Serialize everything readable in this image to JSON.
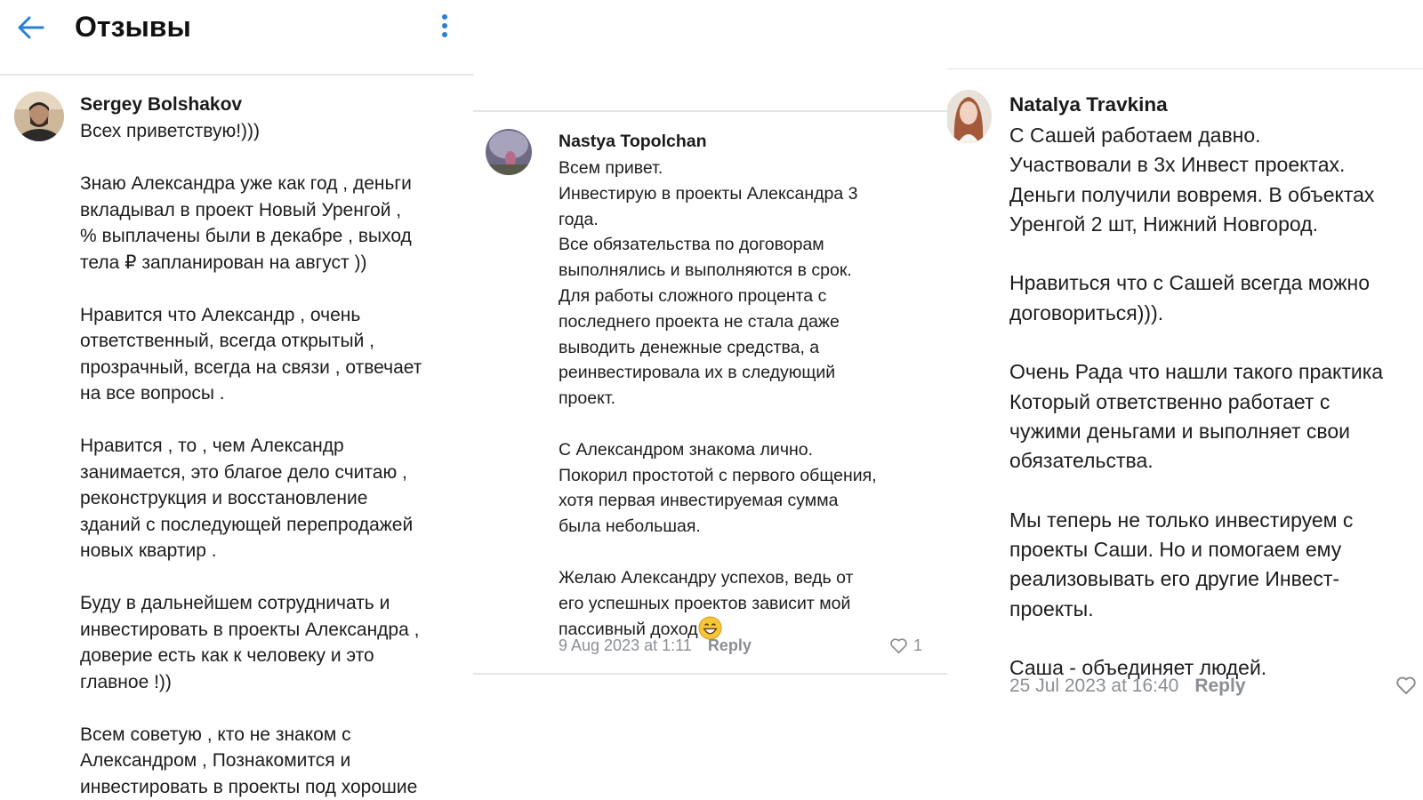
{
  "header": {
    "title": "Отзывы"
  },
  "reviews": [
    {
      "author": "Sergey Bolshakov",
      "text": "Всех приветствую!)))\n\nЗнаю Александра уже как год , деньги\nвкладывал в проект Новый Уренгой ,\n% выплачены были в декабре , выход\nтела ₽ запланирован на август ))\n\nНравится что Александр , очень\nответственный, всегда открытый ,\nпрозрачный, всегда на связи , отвечает\nна все вопросы .\n\nНравится , то , чем Александр\nзанимается, это благое дело считаю ,\nреконструкция и восстановление\nзданий с последующей перепродажей\nновых квартир .\n\nБуду в дальнейшем сотрудничать и\nинвестировать в проекты Александра ,\nдоверие есть как к человеку и это\nглавное !))\n\nВсем советую , кто не знаком с\nАлександром , Познакомится и\nинвестировать в проекты под хорошие"
    },
    {
      "author": "Nastya Topolchan",
      "text": "Всем привет.\nИнвестирую в проекты Александра 3\nгода.\nВсе обязательства по договорам\nвыполнялись и выполняются в срок.\nДля работы сложного процента с\nпоследнего проекта не стала даже\nвыводить денежные средства, а\nреинвестировала их в следующий\nпроект.\n\nС Александром знакома лично.\nПокорил простотой с первого общения,\nхотя первая инвестируемая сумма\nбыла небольшая.\n\nЖелаю Александру успехов, ведь от\nего успешных проектов зависит мой\nпассивный доход",
      "emoji": "😁",
      "date": "9 Aug 2023 at 1:11",
      "reply_label": "Reply",
      "likes": "1"
    },
    {
      "author": "Natalya Travkina",
      "text": "С Сашей работаем давно.\nУчаствовали в 3х Инвест проектах.\nДеньги получили вовремя. В объектах\nУренгой 2 шт, Нижний Новгород.\n\nНравиться что с Сашей всегда можно\nдоговориться))).\n\nОчень Рада что нашли такого практика\nКоторый ответственно работает с\nчужими деньгами и выполняет свои\nобязательства.\n\nМы теперь не только инвестируем с\nпроекты Саши. Но и помогаем ему\nреализовывать его другие Инвест-\nпроекты.\n\nСаша - объединяет людей.",
      "date": "25 Jul 2023 at 16:40",
      "reply_label": "Reply"
    }
  ],
  "icons": {
    "back": "arrow-left-icon",
    "menu": "more-vertical-icon",
    "like": "heart-outline-icon"
  },
  "colors": {
    "accent": "#2a7fd4",
    "meta": "#8b8f94",
    "divider": "#e3e4e6"
  }
}
